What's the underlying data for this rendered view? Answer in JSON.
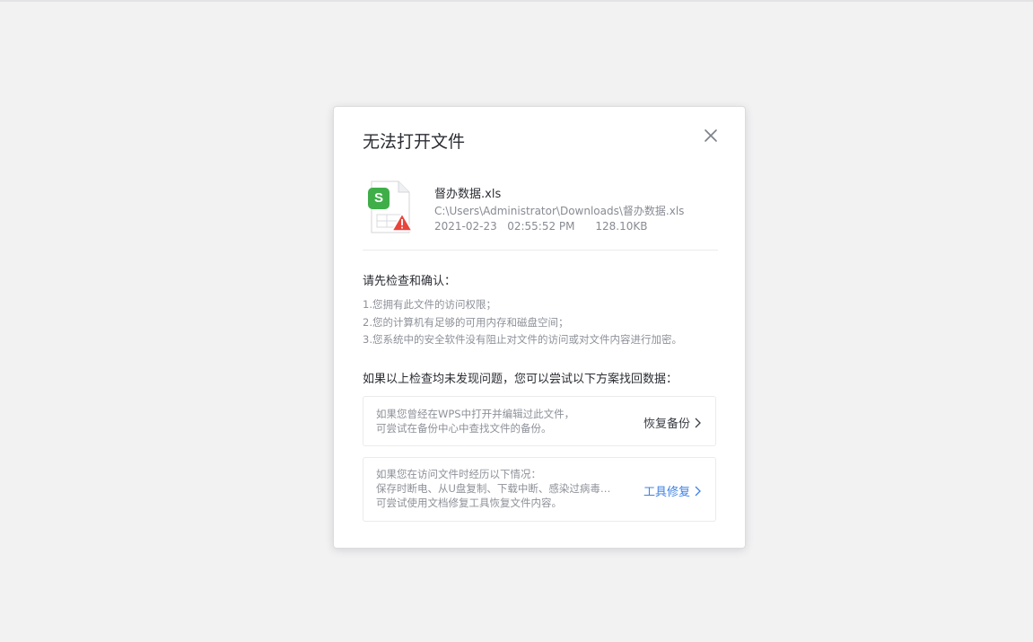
{
  "colors": {
    "background": "#f2f2f3",
    "dialog": "#ffffff",
    "text_primary": "#2b2d33",
    "text_secondary": "#888b93",
    "link": "#3d82e6",
    "sheet_green": "#3fae49",
    "warning_red": "#e8453c"
  },
  "dialog": {
    "title": "无法打开文件",
    "close_icon": "close-icon"
  },
  "file": {
    "icon": "spreadsheet-file-warning-icon",
    "badge_letter": "S",
    "name": "督办数据.xls",
    "path": "C:\\Users\\Administrator\\Downloads\\督办数据.xls",
    "date": "2021-02-23",
    "time": "02:55:52 PM",
    "size": "128.10KB"
  },
  "checks": {
    "heading": "请先检查和确认：",
    "items": [
      "1.您拥有此文件的访问权限；",
      "2.您的计算机有足够的可用内存和磁盘空间；",
      "3.您系统中的安全软件没有阻止对文件的访问或对文件内容进行加密。"
    ]
  },
  "recovery": {
    "heading": "如果以上检查均未发现问题，您可以尝试以下方案找回数据：",
    "options": [
      {
        "lines": [
          "如果您曾经在WPS中打开并编辑过此文件，",
          "可尝试在备份中心中查找文件的备份。"
        ],
        "action": "恢复备份"
      },
      {
        "lines": [
          "如果您在访问文件时经历以下情况：",
          "保存时断电、从U盘复制、下载中断、感染过病毒…",
          "可尝试使用文档修复工具恢复文件内容。"
        ],
        "action": "工具修复"
      }
    ]
  }
}
